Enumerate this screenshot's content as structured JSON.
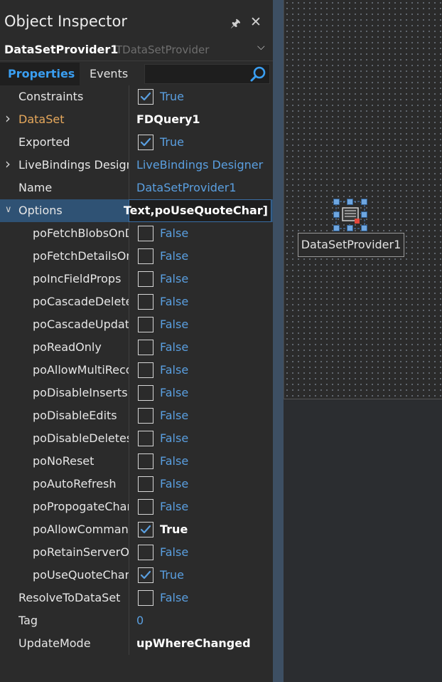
{
  "window": {
    "title": "Object Inspector"
  },
  "selector": {
    "name": "DataSetProvider1",
    "type": "TDataSetProvider"
  },
  "tabs": {
    "properties": "Properties",
    "events": "Events"
  },
  "search": {
    "placeholder": ""
  },
  "properties": [
    {
      "name": "Constraints",
      "checkbox": true,
      "checked": true,
      "value": "True"
    },
    {
      "name": "DataSet",
      "value": "FDQuery1",
      "bold": true,
      "expandable": true,
      "highlight": true
    },
    {
      "name": "Exported",
      "checkbox": true,
      "checked": true,
      "value": "True"
    },
    {
      "name": "LiveBindings Designer",
      "value": "LiveBindings Designer",
      "expandable": true
    },
    {
      "name": "Name",
      "value": "DataSetProvider1"
    },
    {
      "name": "Options",
      "value": "Text,poUseQuoteChar]",
      "expanded": true,
      "selected": true,
      "editing": true
    },
    {
      "name": "poFetchBlobsOnDemand",
      "checkbox": true,
      "checked": false,
      "value": "False",
      "child": true
    },
    {
      "name": "poFetchDetailsOnDemand",
      "checkbox": true,
      "checked": false,
      "value": "False",
      "child": true
    },
    {
      "name": "poIncFieldProps",
      "checkbox": true,
      "checked": false,
      "value": "False",
      "child": true
    },
    {
      "name": "poCascadeDeletes",
      "checkbox": true,
      "checked": false,
      "value": "False",
      "child": true
    },
    {
      "name": "poCascadeUpdates",
      "checkbox": true,
      "checked": false,
      "value": "False",
      "child": true
    },
    {
      "name": "poReadOnly",
      "checkbox": true,
      "checked": false,
      "value": "False",
      "child": true
    },
    {
      "name": "poAllowMultiRecordUpdates",
      "checkbox": true,
      "checked": false,
      "value": "False",
      "child": true
    },
    {
      "name": "poDisableInserts",
      "checkbox": true,
      "checked": false,
      "value": "False",
      "child": true
    },
    {
      "name": "poDisableEdits",
      "checkbox": true,
      "checked": false,
      "value": "False",
      "child": true
    },
    {
      "name": "poDisableDeletes",
      "checkbox": true,
      "checked": false,
      "value": "False",
      "child": true
    },
    {
      "name": "poNoReset",
      "checkbox": true,
      "checked": false,
      "value": "False",
      "child": true
    },
    {
      "name": "poAutoRefresh",
      "checkbox": true,
      "checked": false,
      "value": "False",
      "child": true
    },
    {
      "name": "poPropogateChanges",
      "checkbox": true,
      "checked": false,
      "value": "False",
      "child": true
    },
    {
      "name": "poAllowCommandText",
      "checkbox": true,
      "checked": true,
      "value": "True",
      "bold": true,
      "child": true
    },
    {
      "name": "poRetainServerOrder",
      "checkbox": true,
      "checked": false,
      "value": "False",
      "child": true
    },
    {
      "name": "poUseQuoteChar",
      "checkbox": true,
      "checked": true,
      "value": "True",
      "child": true
    },
    {
      "name": "ResolveToDataSet",
      "checkbox": true,
      "checked": false,
      "value": "False"
    },
    {
      "name": "Tag",
      "value": "0"
    },
    {
      "name": "UpdateMode",
      "value": "upWhereChanged",
      "bold": true
    }
  ],
  "designer": {
    "component_label": "DataSetProvider1"
  },
  "colors": {
    "accent": "#3a9ff2",
    "value_blue": "#5a9fe0",
    "highlight_orange": "#e6a85c",
    "selection": "#2f5274"
  }
}
